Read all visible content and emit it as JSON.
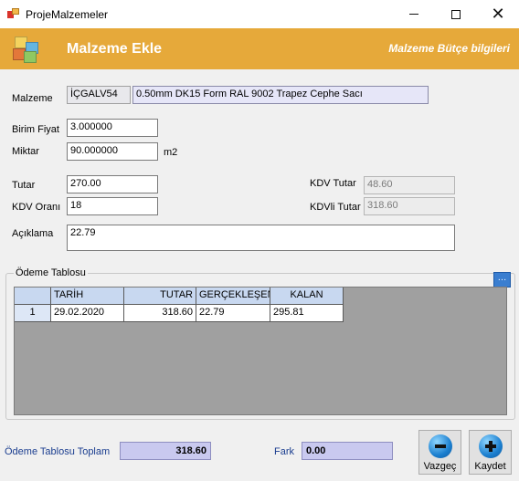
{
  "window": {
    "title": "ProjeMalzemeler"
  },
  "banner": {
    "title": "Malzeme Ekle",
    "subtitle": "Malzeme Bütçe bilgileri"
  },
  "form": {
    "malzeme_label": "Malzeme",
    "malzeme_code": "İÇGALV54",
    "malzeme_name": "0.50mm DK15 Form RAL 9002 Trapez Cephe Sacı",
    "birim_fiyat_label": "Birim Fiyat",
    "birim_fiyat": "3.000000",
    "miktar_label": "Miktar",
    "miktar": "90.000000",
    "miktar_unit": "m2",
    "tutar_label": "Tutar",
    "tutar": "270.00",
    "kdv_orani_label": "KDV Oranı",
    "kdv_orani": "18",
    "kdv_tutar_label": "KDV Tutar",
    "kdv_tutar": "48.60",
    "kdvli_tutar_label": "KDVli Tutar",
    "kdvli_tutar": "318.60",
    "aciklama_label": "Açıklama",
    "aciklama": "22.79"
  },
  "odeme": {
    "group_title": "Ödeme Tablosu",
    "columns": [
      "TARİH",
      "TUTAR",
      "GERÇEKLEŞEN",
      "KALAN"
    ],
    "rows": [
      {
        "no": "1",
        "tarih": "29.02.2020",
        "tutar": "318.60",
        "gerceklesen": "22.79",
        "kalan": "295.81"
      }
    ]
  },
  "footer": {
    "toplam_label": "Ödeme Tablosu Toplam",
    "toplam": "318.60",
    "fark_label": "Fark",
    "fark": "0.00",
    "cancel_label": "Vazgeç",
    "save_label": "Kaydet"
  },
  "colors": {
    "banner": "#e6a93a",
    "sum_box": "#c9c9ef",
    "grid_header": "#c8d8f0",
    "footer_label": "#1a3d8f"
  }
}
